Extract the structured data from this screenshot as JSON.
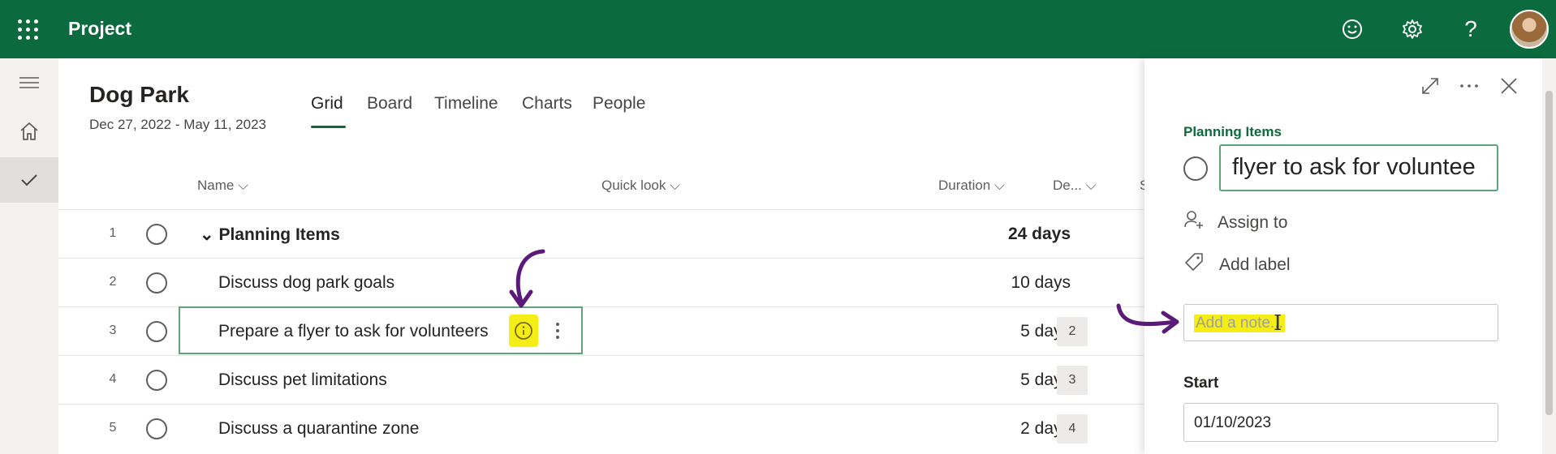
{
  "app": {
    "name": "Project"
  },
  "project": {
    "title": "Dog Park",
    "dates": "Dec 27, 2022 - May 11, 2023"
  },
  "tabs": [
    {
      "label": "Grid",
      "active": true
    },
    {
      "label": "Board"
    },
    {
      "label": "Timeline"
    },
    {
      "label": "Charts"
    },
    {
      "label": "People"
    }
  ],
  "columns": {
    "name": "Name",
    "quick_look": "Quick look",
    "duration": "Duration",
    "dependencies": "De...",
    "cut_off": "S"
  },
  "rows": [
    {
      "num": "1",
      "name": "Planning Items",
      "duration": "24 days",
      "group": true
    },
    {
      "num": "2",
      "name": "Discuss dog park goals",
      "duration": "10 days"
    },
    {
      "num": "3",
      "name": "Prepare a flyer to ask for volunteers",
      "duration": "5 days",
      "dep": "2",
      "selected": true
    },
    {
      "num": "4",
      "name": "Discuss pet limitations",
      "duration": "5 days",
      "dep": "3"
    },
    {
      "num": "5",
      "name": "Discuss a quarantine zone",
      "duration": "2 days",
      "dep": "4"
    }
  ],
  "panel": {
    "bucket": "Planning Items",
    "task_name": "flyer to ask for voluntee",
    "assign_to": "Assign to",
    "add_label": "Add label",
    "notes_placeholder": "Add a note...",
    "start_label": "Start",
    "start_value": "01/10/2023"
  },
  "colors": {
    "brand": "#0b6a3e",
    "highlight": "#f5ee16",
    "annotation": "#5b1a7a"
  }
}
